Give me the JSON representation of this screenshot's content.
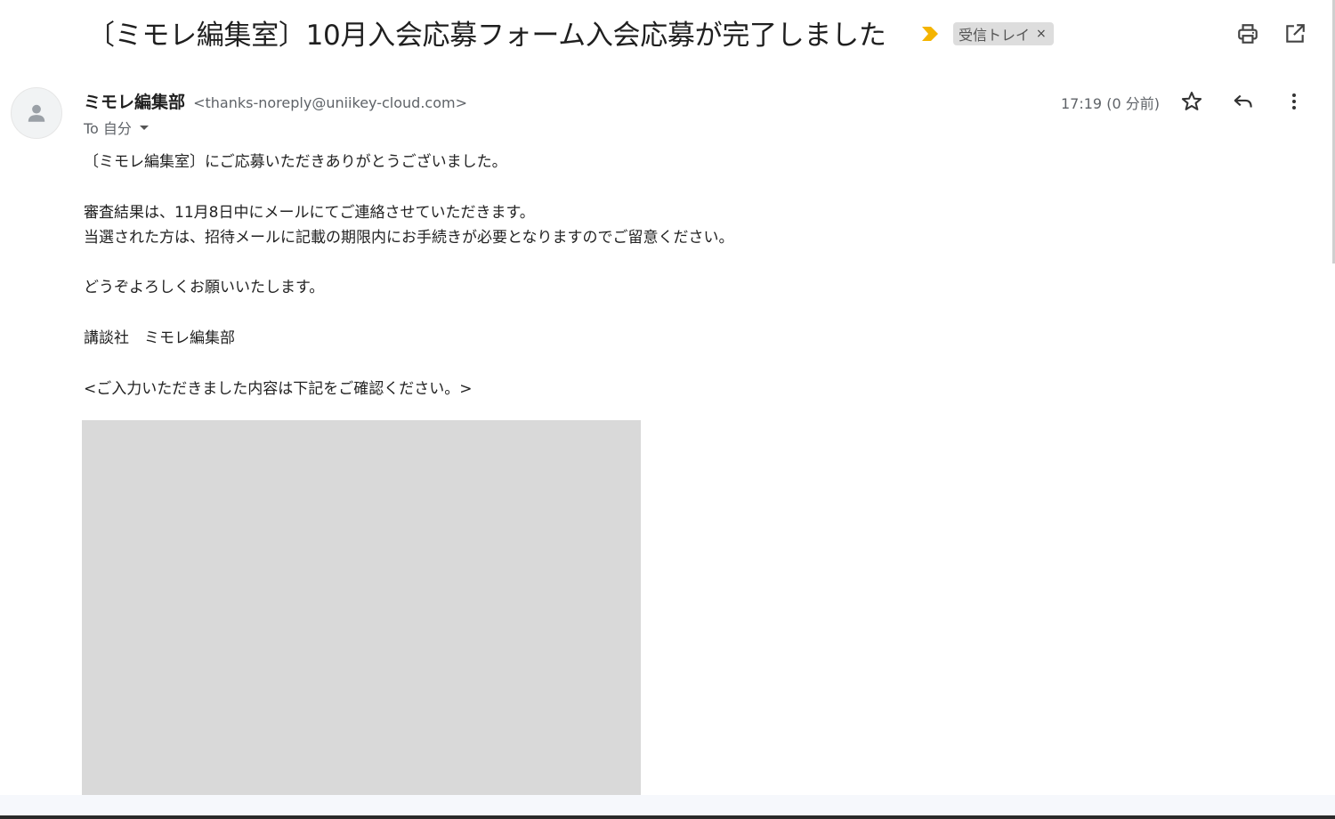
{
  "email": {
    "subject": "〔ミモレ編集室〕10月入会応募フォーム入会応募が完了しました",
    "label": "受信トレイ",
    "label_remove": "×",
    "sender_name": "ミモレ編集部",
    "sender_email": "<thanks-noreply@uniikey-cloud.com>",
    "recipient": "To 自分",
    "time": "17:19 (0 分前)",
    "body_lines": [
      "〔ミモレ編集室〕にご応募いただきありがとうございました。",
      "",
      "審査結果は、11月8日中にメールにてご連絡させていただきます。",
      "当選された方は、招待メールに記載の期限内にお手続きが必要となりますのでご留意ください。",
      "",
      "どうぞよろしくお願いいたします。",
      "",
      "講談社　ミモレ編集部",
      "",
      "<ご入力いただきました内容は下記をご確認ください。>"
    ]
  },
  "icons": {
    "importance": "importance-marker-icon",
    "print": "print-icon",
    "open_new": "open-in-new-window-icon",
    "avatar": "person-icon",
    "star": "star-icon",
    "reply": "reply-icon",
    "more": "more-vertical-icon",
    "dropdown": "chevron-down-icon"
  },
  "colors": {
    "importance": "#f4b400",
    "label_bg": "#dddddd",
    "placeholder": "#d9d9d9"
  }
}
